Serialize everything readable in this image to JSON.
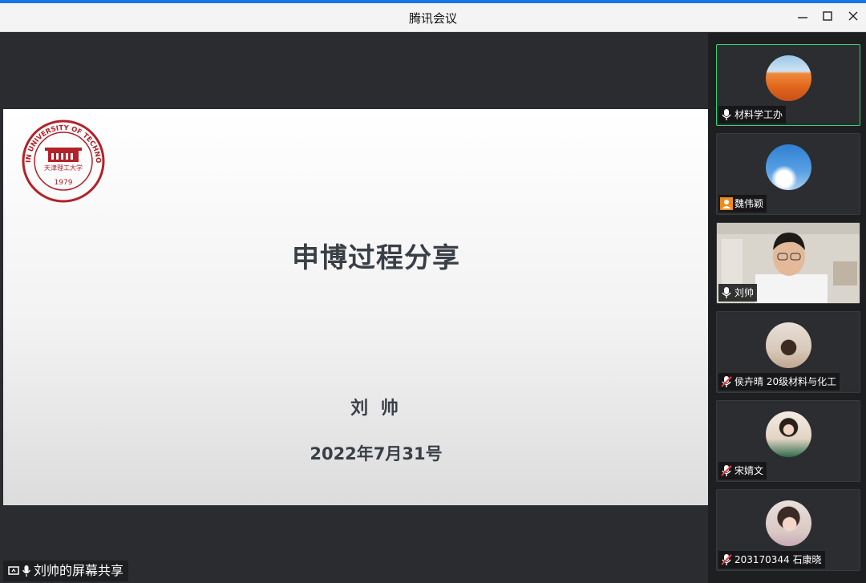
{
  "window": {
    "title": "腾讯会议"
  },
  "slide": {
    "title": "申博过程分享",
    "presenter": "刘  帅",
    "date": "2022年7月31号",
    "logo_text": "TIANJIN UNIVERSITY OF TECHNOLOGY",
    "logo_chinese": "天津理工大学",
    "logo_year": "1979"
  },
  "share_label": "刘帅的屏幕共享",
  "participants": [
    {
      "name": "材料学工办",
      "status": "mic-on",
      "active": true
    },
    {
      "name": "魏伟颖",
      "status": "no-audio"
    },
    {
      "name": "刘帅",
      "status": "mic-on",
      "video": true
    },
    {
      "name": "侯卉晴 20级材料与化工",
      "status": "mic-muted"
    },
    {
      "name": "宋婧文",
      "status": "mic-muted"
    },
    {
      "name": "203170344 石康晓",
      "status": "mic-muted"
    }
  ],
  "colors": {
    "accent": "#1677e6",
    "active_border": "#3ad17a",
    "logo_red": "#b3212a"
  }
}
